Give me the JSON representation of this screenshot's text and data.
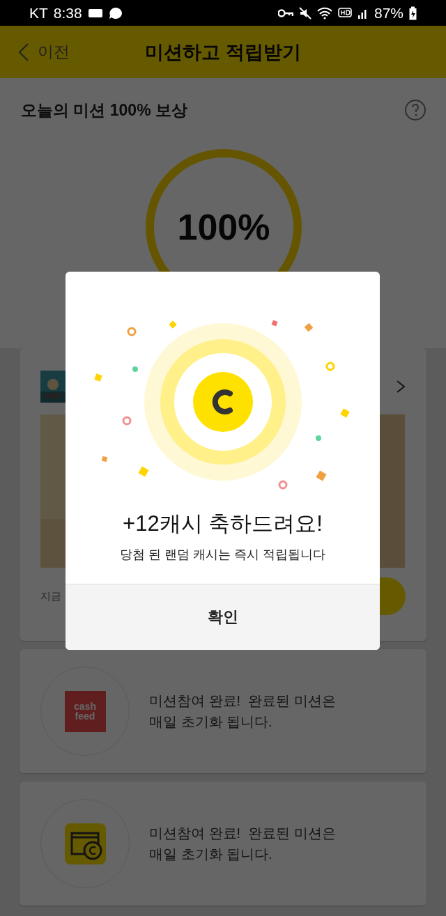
{
  "status_bar": {
    "carrier": "KT",
    "time": "8:38",
    "battery": "87%"
  },
  "header": {
    "back": "이전",
    "title": "미션하고 적립받기"
  },
  "reward": {
    "title": "오늘의 미션 100% 보상",
    "percent": "100%"
  },
  "featured_card": {
    "caption": "지금"
  },
  "missions": [
    {
      "kind": "cashfeed",
      "logo_lines": [
        "cash",
        "feed"
      ],
      "text": "미션참여 완료!  완료된 미션은\n매일 초기화 됩니다."
    },
    {
      "kind": "wallet",
      "text": "미션참여 완료!  완료된 미션은\n매일 초기화 됩니다."
    }
  ],
  "dialog": {
    "title": "+12캐시 축하드려요!",
    "message": "당첨 된 랜덤 캐시는 즉시 적립됩니다",
    "confirm": "확인"
  }
}
